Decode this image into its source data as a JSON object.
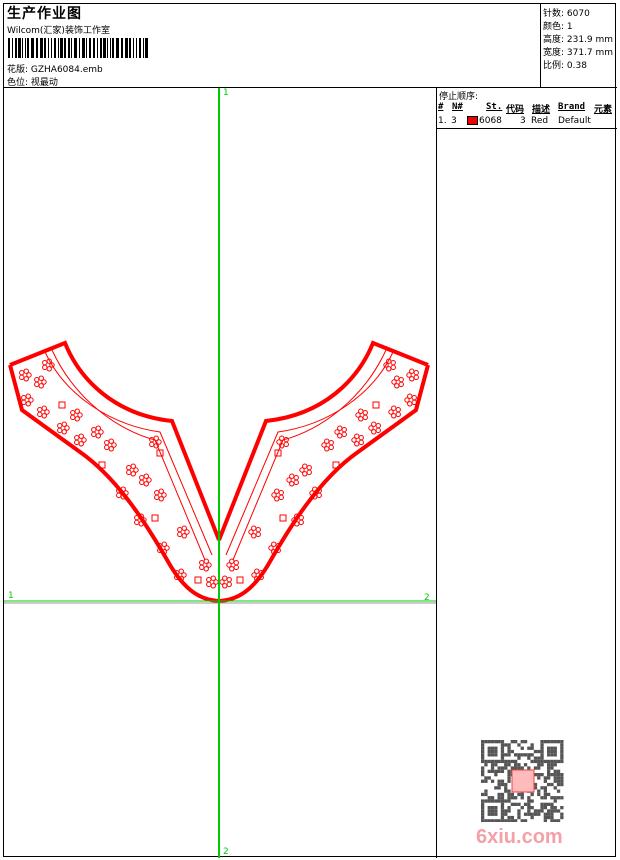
{
  "header": {
    "title": "生产作业图",
    "studio": "Wilcom(汇家)装饰工作室",
    "design_file": "花版: GZHA6084.emb",
    "color_position": "色位: 视最动"
  },
  "stats": {
    "stitches": "针数: 6070",
    "colors": "颜色: 1",
    "height": "高度: 231.9 mm",
    "width": "宽度: 371.7 mm",
    "scale": "比例: 0.38"
  },
  "stop_sequence": {
    "title": "停止顺序:",
    "columns": [
      "#",
      "N#",
      "St.",
      "代码",
      "描述",
      "Brand",
      "元素"
    ],
    "rows": [
      {
        "index": "1.",
        "needle": "3",
        "color": "#e00000",
        "stitches": "6068",
        "code": "3",
        "description": "Red",
        "brand": "Default"
      }
    ]
  },
  "axes": {
    "h_start": "1",
    "h_end": "2",
    "v_start": "1",
    "v_end": "2"
  },
  "watermark": "6xiu.com",
  "colors": {
    "thread": "#ff0000",
    "axis": "#00cc00"
  }
}
